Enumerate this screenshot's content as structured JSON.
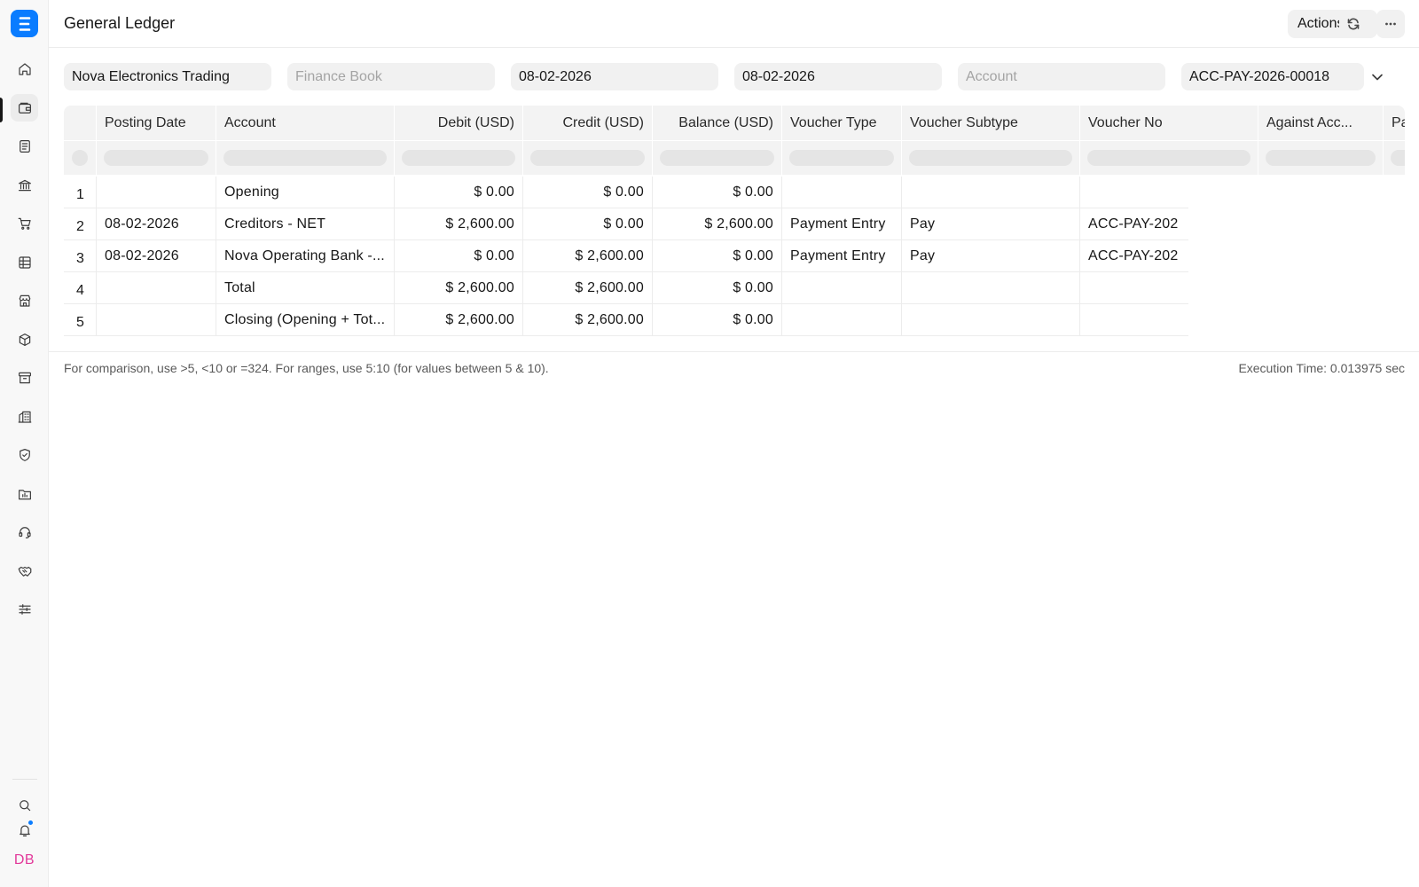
{
  "app": {
    "logo_letter": "E",
    "user_initials": "DB"
  },
  "sidebar": {
    "items": [
      {
        "name": "home-icon"
      },
      {
        "name": "wallet-icon",
        "active": true
      },
      {
        "name": "document-icon"
      },
      {
        "name": "bank-icon"
      },
      {
        "name": "cart-icon"
      },
      {
        "name": "table-icon"
      },
      {
        "name": "store-icon"
      },
      {
        "name": "package-icon"
      },
      {
        "name": "archive-icon"
      },
      {
        "name": "building-icon"
      },
      {
        "name": "shield-icon"
      },
      {
        "name": "folder-chart-icon"
      },
      {
        "name": "headset-icon"
      },
      {
        "name": "handshake-icon"
      },
      {
        "name": "sliders-icon"
      }
    ],
    "bottom": [
      {
        "name": "search-icon"
      },
      {
        "name": "bell-icon"
      }
    ]
  },
  "header": {
    "title": "General Ledger",
    "actions_label": "Actions"
  },
  "filters": {
    "company": "Nova Electronics Trading",
    "finance_book_placeholder": "Finance Book",
    "from_date": "08-02-2026",
    "to_date": "08-02-2026",
    "account_placeholder": "Account",
    "voucher_no": "ACC-PAY-2026-00018"
  },
  "table": {
    "columns": [
      {
        "label": "",
        "align": "left"
      },
      {
        "label": "Posting Date",
        "align": "left"
      },
      {
        "label": "Account",
        "align": "left"
      },
      {
        "label": "Debit (USD)",
        "align": "right"
      },
      {
        "label": "Credit (USD)",
        "align": "right"
      },
      {
        "label": "Balance (USD)",
        "align": "right"
      },
      {
        "label": "Voucher Type",
        "align": "left"
      },
      {
        "label": "Voucher Subtype",
        "align": "left"
      },
      {
        "label": "Voucher No",
        "align": "left"
      },
      {
        "label": "Against Acc...",
        "align": "left"
      },
      {
        "label": "Par",
        "align": "left"
      }
    ],
    "rows": [
      [
        "1",
        "",
        "Opening",
        "$ 0.00",
        "$ 0.00",
        "$ 0.00",
        "",
        "",
        ""
      ],
      [
        "2",
        "08-02-2026",
        "Creditors - NET",
        "$ 2,600.00",
        "$ 0.00",
        "$ 2,600.00",
        "Payment Entry",
        "Pay",
        "ACC-PAY-202"
      ],
      [
        "3",
        "08-02-2026",
        "Nova Operating Bank -...",
        "$ 0.00",
        "$ 2,600.00",
        "$ 0.00",
        "Payment Entry",
        "Pay",
        "ACC-PAY-202"
      ],
      [
        "4",
        "",
        "Total",
        "$ 2,600.00",
        "$ 2,600.00",
        "$ 0.00",
        "",
        "",
        ""
      ],
      [
        "5",
        "",
        "Closing (Opening + Tot...",
        "$ 2,600.00",
        "$ 2,600.00",
        "$ 0.00",
        "",
        "",
        ""
      ]
    ]
  },
  "footer": {
    "note": "For comparison, use >5, <10 or =324. For ranges, use 5:10 (for values between 5 & 10).",
    "execution_time": "Execution Time: 0.013975 sec"
  }
}
